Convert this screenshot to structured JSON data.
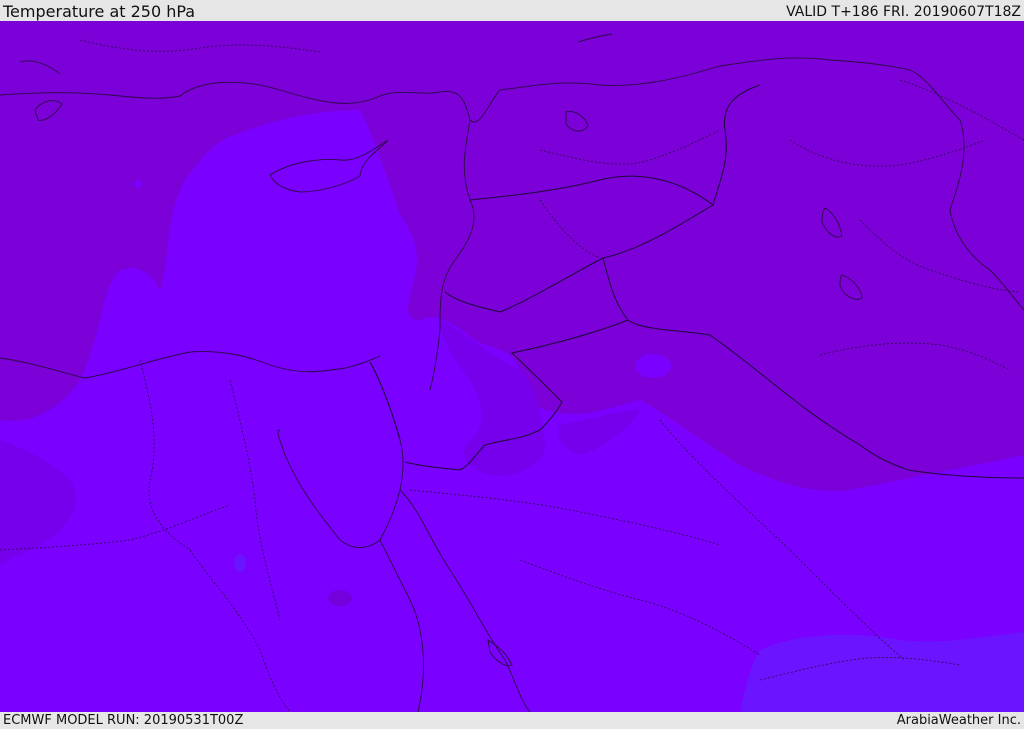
{
  "header": {
    "title": "Temperature at 250 hPa",
    "valid": "VALID T+186 FRI. 20190607T18Z"
  },
  "footer": {
    "model_run": "ECMWF MODEL RUN: 20190531T00Z",
    "credit": "ArabiaWeather Inc."
  },
  "map": {
    "colors": {
      "band_dark": "#7c00d8",
      "band_mid": "#7b00f0",
      "band_light": "#7a00ff",
      "band_blue": "#6a14ff",
      "border": "#2b0a45"
    }
  }
}
